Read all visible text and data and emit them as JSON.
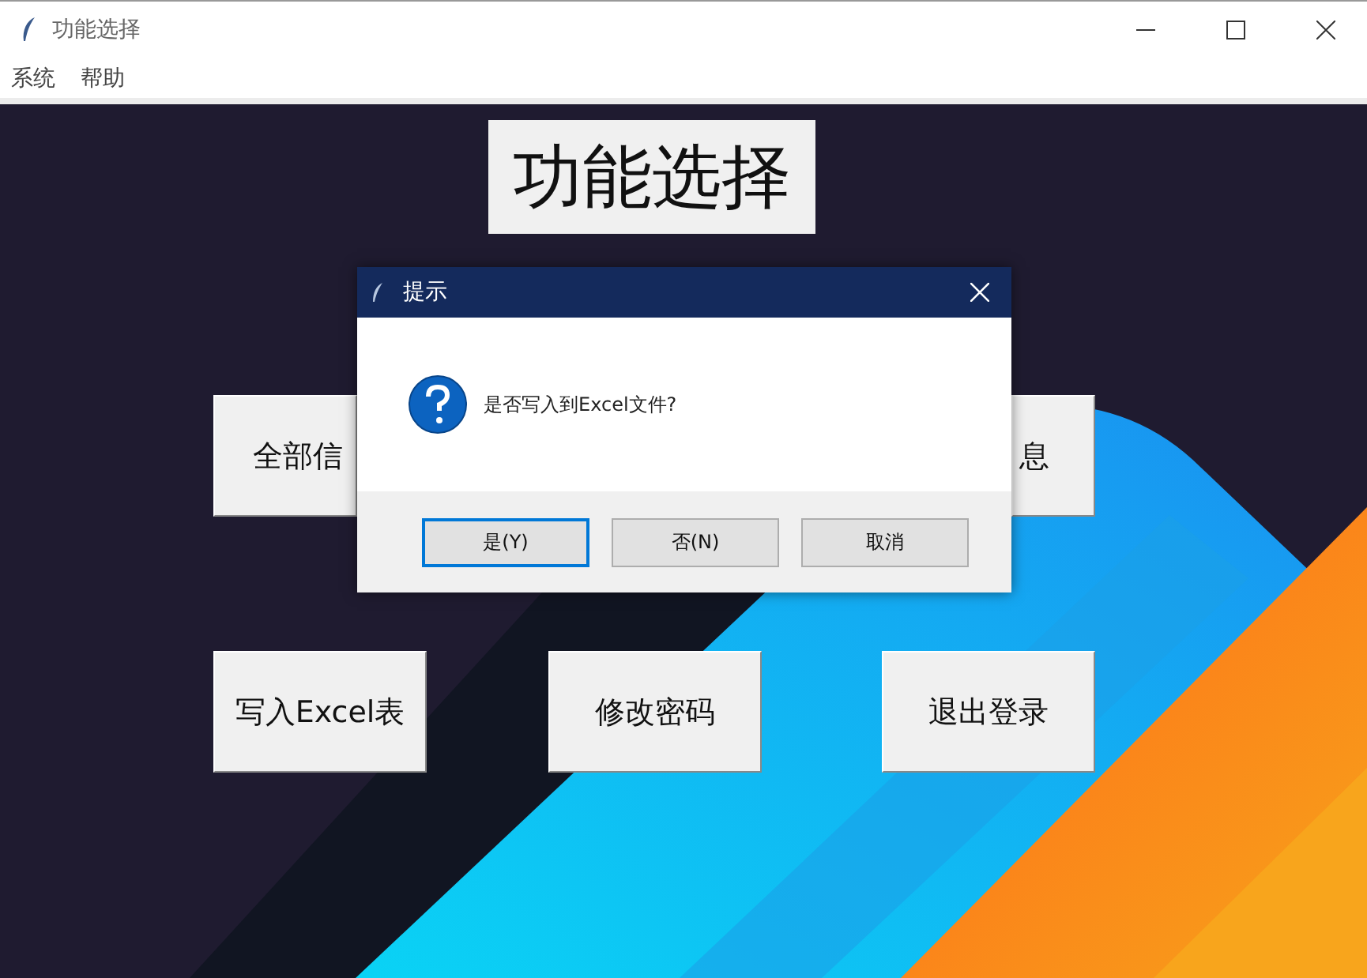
{
  "window": {
    "title": "功能选择"
  },
  "menu": [
    "系统",
    "帮助"
  ],
  "heading": "功能选择",
  "buttons": [
    "全部信",
    "息",
    "写入Excel表",
    "修改密码",
    "退出登录"
  ],
  "dialog": {
    "title": "提示",
    "message": "是否写入到Excel文件?",
    "buttons": [
      {
        "label": "是(Y)",
        "selected": true
      },
      {
        "label": "否(N)",
        "selected": false
      },
      {
        "label": "取消",
        "selected": false
      }
    ]
  }
}
